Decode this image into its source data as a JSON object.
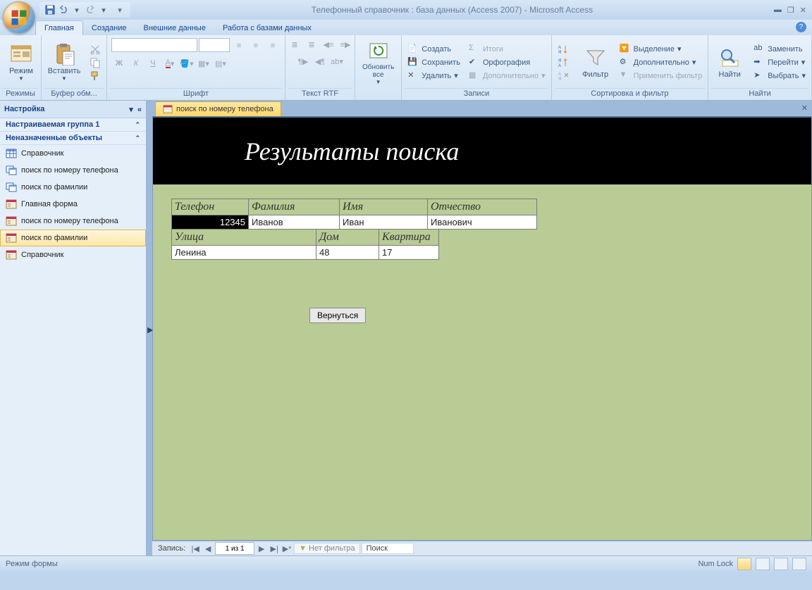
{
  "app_title": "Телефонный справочник : база данных (Access 2007) - Microsoft Access",
  "tabs": {
    "home": "Главная",
    "create": "Создание",
    "external": "Внешние данные",
    "dbtools": "Работа с базами данных"
  },
  "ribbon": {
    "views": "Режимы",
    "view": "Режим",
    "clipboard": "Буфер обм...",
    "paste": "Вставить",
    "font": "Шрифт",
    "rtf": "Текст RTF",
    "refresh": "Обновить все",
    "records": "Записи",
    "create": "Создать",
    "save": "Сохранить",
    "delete": "Удалить",
    "totals": "Итоги",
    "spell": "Орфография",
    "more": "Дополнительно",
    "sortfilter": "Сортировка и фильтр",
    "filter": "Фильтр",
    "selection": "Выделение",
    "advanced": "Дополнительно",
    "apply": "Применить фильтр",
    "find": "Найти",
    "replace": "Заменить",
    "goto": "Перейти",
    "select": "Выбрать"
  },
  "nav": {
    "title": "Настройка",
    "grp1": "Настраиваемая группа 1",
    "grp2": "Неназначенные объекты",
    "items": [
      "Справочник",
      "поиск по номеру телефона",
      "поиск по фамилии",
      "Главная форма",
      "поиск по номеру телефона",
      "поиск по фамилии",
      "Справочник"
    ]
  },
  "doc_tab": "поиск по номеру телефона",
  "form": {
    "title": "Результаты поиска",
    "h": {
      "tel": "Телефон",
      "fam": "Фамилия",
      "name": "Имя",
      "mid": "Отчество",
      "street": "Улица",
      "house": "Дом",
      "apt": "Квартира"
    },
    "d": {
      "tel": "12345",
      "fam": "Иванов",
      "name": "Иван",
      "mid": "Иванович",
      "street": "Ленина",
      "house": "48",
      "apt": "17"
    },
    "back": "Вернуться"
  },
  "recnav": {
    "label": "Запись:",
    "pos": "1 из 1",
    "nofilter": "Нет фильтра",
    "search": "Поиск"
  },
  "status": {
    "mode": "Режим формы",
    "numlock": "Num Lock"
  }
}
